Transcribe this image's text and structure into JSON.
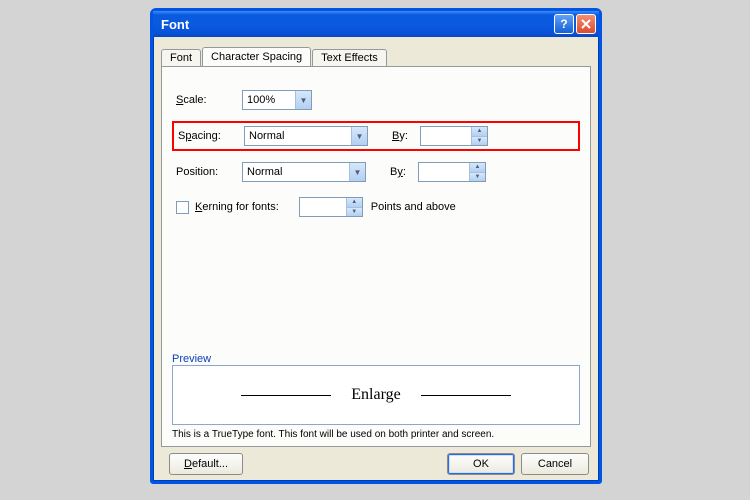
{
  "window": {
    "title": "Font"
  },
  "tabs": {
    "font": "Font",
    "spacing": "Character Spacing",
    "effects": "Text Effects",
    "active": "spacing"
  },
  "fields": {
    "scale_label": "Scale:",
    "scale_value": "100%",
    "spacing_label": "Spacing:",
    "spacing_value": "Normal",
    "spacing_by_label": "By:",
    "spacing_by_value": "",
    "position_label": "Position:",
    "position_value": "Normal",
    "position_by_label": "By:",
    "position_by_value": "",
    "kerning_label": "Kerning for fonts:",
    "kerning_value": "",
    "kerning_suffix": "Points and above"
  },
  "preview": {
    "label": "Preview",
    "text": "Enlarge",
    "footnote": "This is a TrueType font. This font will be used on both printer and screen."
  },
  "buttons": {
    "default": "Default...",
    "ok": "OK",
    "cancel": "Cancel"
  }
}
